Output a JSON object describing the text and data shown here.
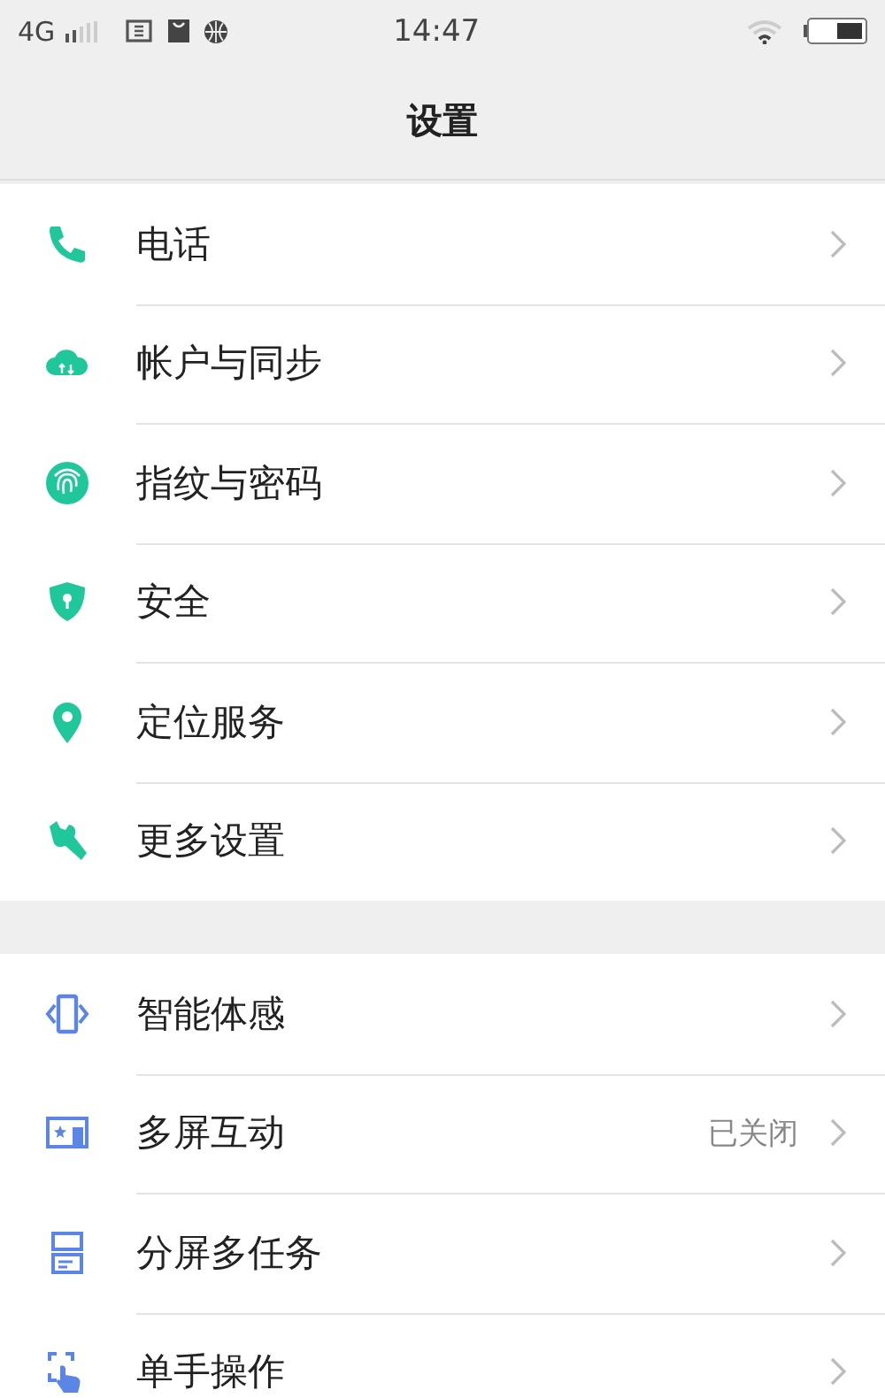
{
  "status_bar": {
    "network": "4G",
    "time": "14:47"
  },
  "header": {
    "title": "设置"
  },
  "groups": [
    {
      "items": [
        {
          "label": "电话"
        },
        {
          "label": "帐户与同步"
        },
        {
          "label": "指纹与密码"
        },
        {
          "label": "安全"
        },
        {
          "label": "定位服务"
        },
        {
          "label": "更多设置"
        }
      ]
    },
    {
      "items": [
        {
          "label": "智能体感"
        },
        {
          "label": "多屏互动",
          "value": "已关闭"
        },
        {
          "label": "分屏多任务"
        },
        {
          "label": "单手操作"
        }
      ]
    }
  ]
}
